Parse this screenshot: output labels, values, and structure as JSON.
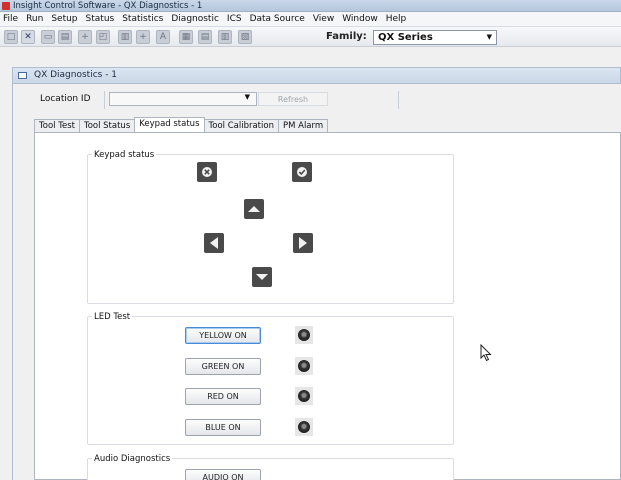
{
  "window": {
    "title": "Insight Control Software - QX Diagnostics - 1"
  },
  "menu": [
    "File",
    "Run",
    "Setup",
    "Status",
    "Statistics",
    "Diagnostic",
    "ICS",
    "Data Source",
    "View",
    "Window",
    "Help"
  ],
  "toolbar": {
    "family_label": "Family:",
    "family_value": "QX Series",
    "icons": [
      "new-icon",
      "delete-icon",
      "open-icon",
      "save-icon",
      "add-icon",
      "document-icon",
      "print-icon",
      "add-small-icon",
      "text-icon",
      "grid-icon",
      "table-icon",
      "columns-icon",
      "chart-icon"
    ]
  },
  "child_window": {
    "title": "QX Diagnostics - 1"
  },
  "location": {
    "label": "Location ID",
    "value": "",
    "refresh_label": "Refresh"
  },
  "tabs": [
    {
      "label": "Tool Test",
      "active": false
    },
    {
      "label": "Tool Status",
      "active": false
    },
    {
      "label": "Keypad status",
      "active": true
    },
    {
      "label": "Tool Calibration",
      "active": false
    },
    {
      "label": "PM Alarm",
      "active": false
    }
  ],
  "keypad": {
    "title": "Keypad status",
    "keys": [
      "cancel-icon",
      "ok-check-icon",
      "up-arrow-icon",
      "left-arrow-icon",
      "right-arrow-icon",
      "down-arrow-icon"
    ]
  },
  "led_test": {
    "title": "LED Test",
    "buttons": [
      {
        "label": "YELLOW ON",
        "focused": true
      },
      {
        "label": "GREEN ON",
        "focused": false
      },
      {
        "label": "RED ON",
        "focused": false
      },
      {
        "label": "BLUE ON",
        "focused": false
      }
    ]
  },
  "audio": {
    "title": "Audio Diagnostics",
    "button_label": "AUDIO ON"
  },
  "colors": {
    "title_bar": "#c9d8ea",
    "focus_border": "#4a8ad6",
    "keypad_key": "#4a4a4a"
  }
}
